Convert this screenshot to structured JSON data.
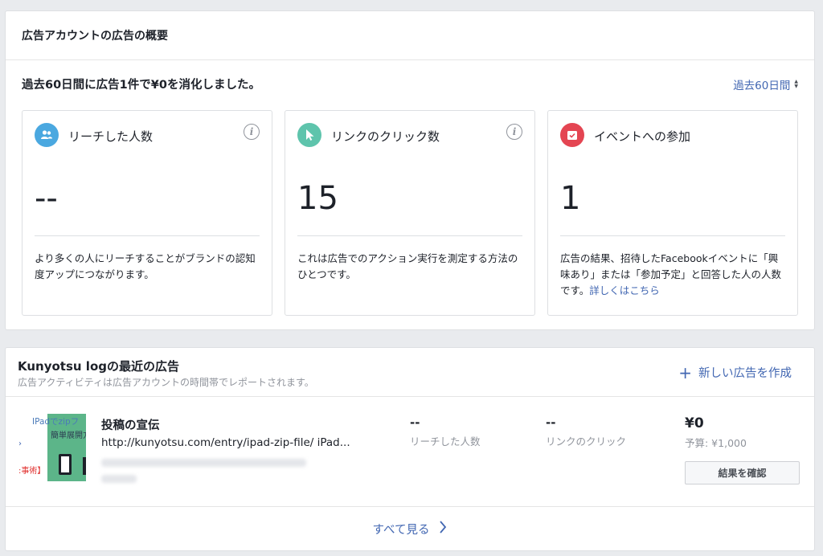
{
  "overview": {
    "title": "広告アカウントの広告の概要",
    "summary": "過去60日間に広告1件で¥0を消化しました。",
    "period_label": "過去60日間",
    "cards": [
      {
        "title": "リーチした人数",
        "value": "--",
        "desc": "より多くの人にリーチすることがブランドの認知度アップにつながります。",
        "icon": "people-icon",
        "color": "#4aa8e0"
      },
      {
        "title": "リンクのクリック数",
        "value": "15",
        "desc": "これは広告でのアクション実行を測定する方法のひとつです。",
        "icon": "cursor-icon",
        "color": "#5ec4ac"
      },
      {
        "title": "イベントへの参加",
        "value": "1",
        "desc": "広告の結果、招待したFacebookイベントに「興味あり」または「参加予定」と回答した人の人数です。",
        "link": "詳しくはこちら",
        "icon": "calendar-icon",
        "color": "#e44552"
      }
    ]
  },
  "recent": {
    "title": "Kunyotsu logの最近の広告",
    "subtitle": "広告アクティビティは広告アカウントの時間帯でレポートされます。",
    "create_label": "新しい広告を作成",
    "ad": {
      "thumb_line1": "IPadでzipフ",
      "thumb_line2": "簡単展開方法",
      "thumb_red": ":事術】",
      "name": "投稿の宣伝",
      "url": "http://kunyotsu.com/entry/ipad-zip-file/ iPad...",
      "reach_value": "--",
      "reach_label": "リーチした人数",
      "click_value": "--",
      "click_label": "リンクのクリック",
      "spend": "¥0",
      "budget": "予算: ¥1,000",
      "result_button": "結果を確認"
    },
    "see_all": "すべて見る"
  }
}
